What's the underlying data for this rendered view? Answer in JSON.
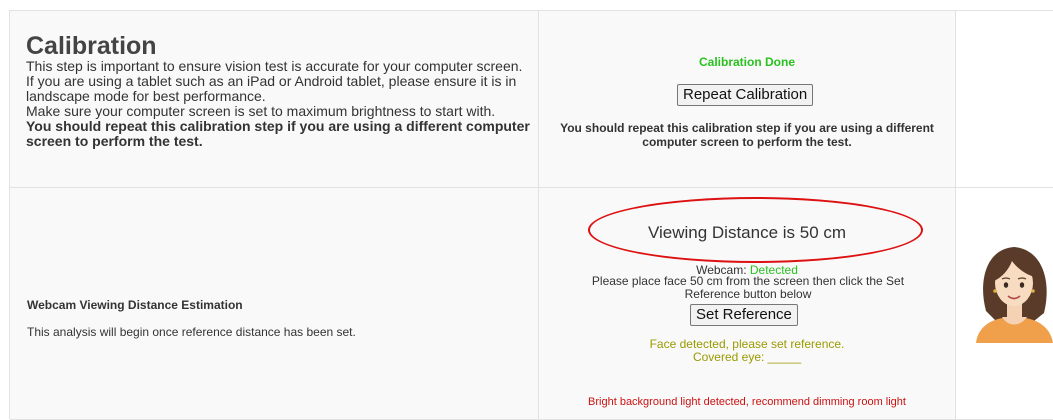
{
  "calibration": {
    "title": "Calibration",
    "line1": "This step is important to ensure vision test is accurate for your computer screen.",
    "line2": "If you are using a tablet such as an iPad or Android tablet, please ensure it is in landscape mode for best performance.",
    "line3": "Make sure your computer screen is set to maximum brightness to start with.",
    "line4_bold": "You should repeat this calibration step if you are using a different computer screen to perform the test.",
    "status": "Calibration Done",
    "repeat_button": "Repeat Calibration",
    "repeat_note": "You should repeat this calibration step if you are using a different computer screen to perform the test."
  },
  "webcam": {
    "title": "Webcam Viewing Distance Estimation",
    "description": "This analysis will begin once reference distance has been set.",
    "viewing_distance": "Viewing Distance is 50 cm",
    "webcam_label": "Webcam: ",
    "webcam_status": "Detected",
    "place_instruction": "Please place face 50 cm from the screen then click the Set Reference button below",
    "set_reference_button": "Set Reference",
    "face_detected": "Face detected, please set reference.",
    "covered_eye": "Covered eye: _____",
    "bright_warning": "Bright background light detected, recommend dimming room light"
  },
  "colors": {
    "success": "#29c21f",
    "warning": "#9a9a00",
    "error": "#cc1111",
    "highlight_ellipse": "#dd1111"
  }
}
